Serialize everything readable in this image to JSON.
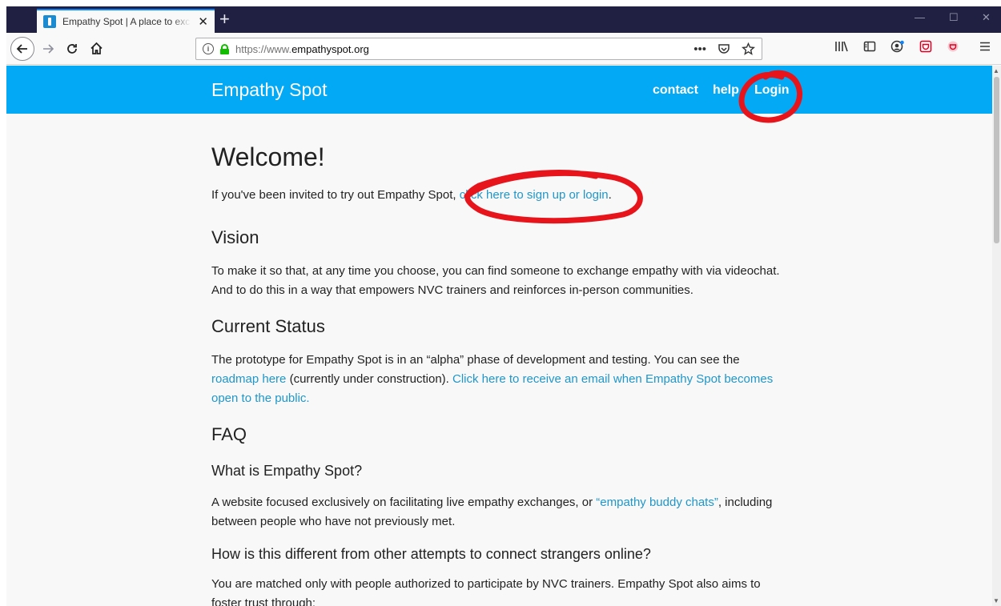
{
  "browser": {
    "tab_title": "Empathy Spot | A place to exchange empathy",
    "tab_close": "✕",
    "new_tab": "+",
    "url_prefix": "https://www.",
    "url_domain": "empathyspot.org",
    "window_controls": [
      "—",
      "☐",
      "✕"
    ]
  },
  "site": {
    "brand": "Empathy Spot",
    "nav": {
      "contact": "contact",
      "help": "help",
      "login": "Login"
    }
  },
  "page": {
    "welcome_heading": "Welcome!",
    "invite_prefix": "If you've been invited to try out Empathy Spot, ",
    "invite_link": "click here to sign up or login",
    "invite_suffix": ".",
    "vision_heading": "Vision",
    "vision_text": "To make it so that, at any time you choose, you can find someone to exchange empathy with via videochat. And to do this in a way that empowers NVC trainers and reinforces in-person communities.",
    "status_heading": "Current Status",
    "status_prefix": "The prototype for Empathy Spot is in an “alpha” phase of development and testing. You can see the ",
    "status_link_roadmap": "roadmap here",
    "status_mid": " (currently under construction). ",
    "status_link_email": "Click here to receive an email when Empathy Spot becomes open to the public.",
    "faq_heading": "FAQ",
    "faq_q1": "What is Empathy Spot?",
    "faq_a1_prefix": "A website focused exclusively on facilitating live empathy exchanges, or ",
    "faq_a1_link": "“empathy buddy chats”",
    "faq_a1_suffix": ", including between people who have not previously met.",
    "faq_q2": "How is this different from other attempts to connect strangers online?",
    "faq_a2": "You are matched only with people authorized to participate by NVC trainers. Empathy Spot also aims to foster trust through:"
  },
  "colors": {
    "header_bg": "#03a9f4",
    "link": "#2196c9",
    "annotation": "#e8141c",
    "tabstrip": "#1f2042"
  }
}
